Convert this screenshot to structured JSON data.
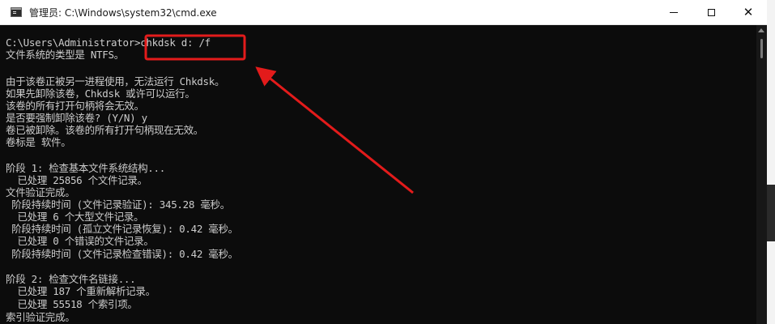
{
  "window": {
    "title": "管理员: C:\\Windows\\system32\\cmd.exe",
    "minimize_label": "Minimize",
    "maximize_label": "Maximize",
    "close_label": "Close"
  },
  "console": {
    "lines": [
      "C:\\Users\\Administrator>chkdsk d: /f",
      "文件系统的类型是 NTFS。",
      "",
      "由于该卷正被另一进程使用，无法运行 Chkdsk。",
      "如果先卸除该卷，Chkdsk 或许可以运行。",
      "该卷的所有打开句柄将会无效。",
      "是否要强制卸除该卷? (Y/N) y",
      "卷已被卸除。该卷的所有打开句柄现在无效。",
      "卷标是 软件。",
      "",
      "阶段 1: 检查基本文件系统结构...",
      "  已处理 25856 个文件记录。",
      "文件验证完成。",
      " 阶段持续时间 (文件记录验证): 345.28 毫秒。",
      "  已处理 6 个大型文件记录。",
      " 阶段持续时间 (孤立文件记录恢复): 0.42 毫秒。",
      "  已处理 0 个错误的文件记录。",
      " 阶段持续时间 (文件记录检查错误): 0.42 毫秒。",
      "",
      "阶段 2: 检查文件名链接...",
      "  已处理 187 个重新解析记录。",
      "  已处理 55518 个索引项。",
      "索引验证完成。"
    ]
  },
  "colors": {
    "console_bg": "#0c0c0c",
    "console_text": "#cccccc",
    "highlight": "#e31b1b",
    "titlebar_bg": "#ffffff"
  }
}
